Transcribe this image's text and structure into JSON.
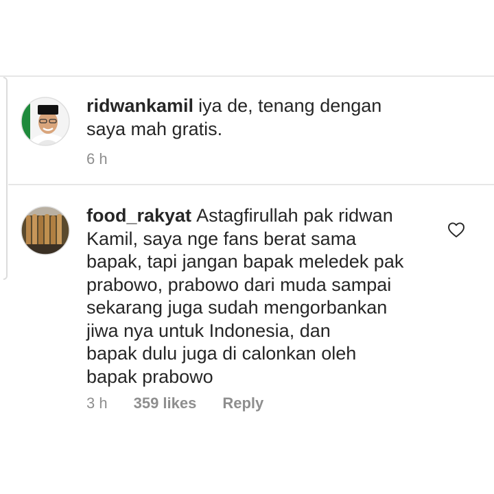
{
  "comments": [
    {
      "username": "ridwankamil",
      "text": "iya de, tenang dengan\nsaya mah gratis.",
      "time": "6 h"
    },
    {
      "username": "food_rakyat",
      "text": "Astagfirullah pak ridwan\nKamil, saya nge fans berat sama\nbapak, tapi jangan bapak meledek pak\nprabowo, prabowo dari muda sampai\nsekarang juga sudah mengorbankan\njiwa nya untuk Indonesia, dan\nbapak dulu juga di calonkan oleh\nbapak prabowo",
      "time": "3 h",
      "likes": "359 likes",
      "reply_label": "Reply"
    }
  ],
  "icons": {
    "like": "heart-outline-icon"
  },
  "colors": {
    "text": "#262626",
    "meta": "#8e8e8e",
    "divider": "#e6e6e6"
  }
}
